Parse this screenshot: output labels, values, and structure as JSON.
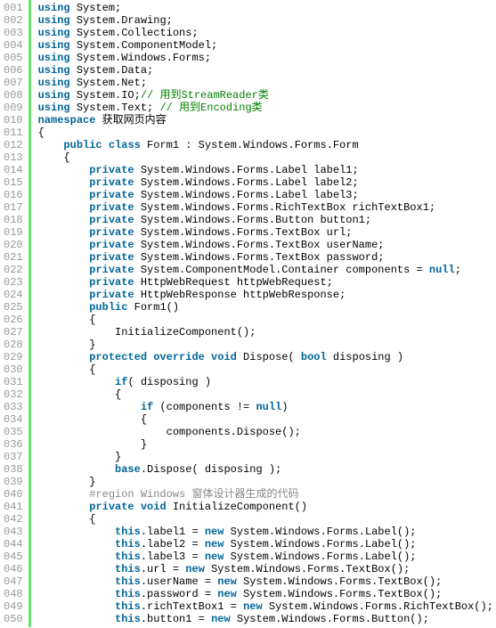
{
  "lines": [
    {
      "n": "001",
      "t": [
        [
          "kw",
          "using"
        ],
        [
          "pl",
          " System;"
        ]
      ]
    },
    {
      "n": "002",
      "t": [
        [
          "kw",
          "using"
        ],
        [
          "pl",
          " System.Drawing;"
        ]
      ]
    },
    {
      "n": "003",
      "t": [
        [
          "kw",
          "using"
        ],
        [
          "pl",
          " System.Collections;"
        ]
      ]
    },
    {
      "n": "004",
      "t": [
        [
          "kw",
          "using"
        ],
        [
          "pl",
          " System.ComponentModel;"
        ]
      ]
    },
    {
      "n": "005",
      "t": [
        [
          "kw",
          "using"
        ],
        [
          "pl",
          " System.Windows.Forms;"
        ]
      ]
    },
    {
      "n": "006",
      "t": [
        [
          "kw",
          "using"
        ],
        [
          "pl",
          " System.Data;"
        ]
      ]
    },
    {
      "n": "007",
      "t": [
        [
          "kw",
          "using"
        ],
        [
          "pl",
          " System.Net;"
        ]
      ]
    },
    {
      "n": "008",
      "t": [
        [
          "kw",
          "using"
        ],
        [
          "pl",
          " System.IO;"
        ],
        [
          "cmt",
          "// 用到StreamReader类"
        ]
      ]
    },
    {
      "n": "009",
      "t": [
        [
          "kw",
          "using"
        ],
        [
          "pl",
          " System.Text; "
        ],
        [
          "cmt",
          "// 用到Encoding类"
        ]
      ]
    },
    {
      "n": "010",
      "t": [
        [
          "kw",
          "namespace"
        ],
        [
          "pl",
          " 获取网页内容"
        ]
      ]
    },
    {
      "n": "011",
      "t": [
        [
          "pl",
          "{"
        ]
      ]
    },
    {
      "n": "012",
      "t": [
        [
          "pl",
          "    "
        ],
        [
          "kw",
          "public"
        ],
        [
          "pl",
          " "
        ],
        [
          "kw",
          "class"
        ],
        [
          "pl",
          " Form1 : System.Windows.Forms.Form"
        ]
      ]
    },
    {
      "n": "013",
      "t": [
        [
          "pl",
          "    {"
        ]
      ]
    },
    {
      "n": "014",
      "t": [
        [
          "pl",
          "        "
        ],
        [
          "kw",
          "private"
        ],
        [
          "pl",
          " System.Windows.Forms.Label label1;"
        ]
      ]
    },
    {
      "n": "015",
      "t": [
        [
          "pl",
          "        "
        ],
        [
          "kw",
          "private"
        ],
        [
          "pl",
          " System.Windows.Forms.Label label2;"
        ]
      ]
    },
    {
      "n": "016",
      "t": [
        [
          "pl",
          "        "
        ],
        [
          "kw",
          "private"
        ],
        [
          "pl",
          " System.Windows.Forms.Label label3;"
        ]
      ]
    },
    {
      "n": "017",
      "t": [
        [
          "pl",
          "        "
        ],
        [
          "kw",
          "private"
        ],
        [
          "pl",
          " System.Windows.Forms.RichTextBox richTextBox1;"
        ]
      ]
    },
    {
      "n": "018",
      "t": [
        [
          "pl",
          "        "
        ],
        [
          "kw",
          "private"
        ],
        [
          "pl",
          " System.Windows.Forms.Button button1;"
        ]
      ]
    },
    {
      "n": "019",
      "t": [
        [
          "pl",
          "        "
        ],
        [
          "kw",
          "private"
        ],
        [
          "pl",
          " System.Windows.Forms.TextBox url;"
        ]
      ]
    },
    {
      "n": "020",
      "t": [
        [
          "pl",
          "        "
        ],
        [
          "kw",
          "private"
        ],
        [
          "pl",
          " System.Windows.Forms.TextBox userName;"
        ]
      ]
    },
    {
      "n": "021",
      "t": [
        [
          "pl",
          "        "
        ],
        [
          "kw",
          "private"
        ],
        [
          "pl",
          " System.Windows.Forms.TextBox password;"
        ]
      ]
    },
    {
      "n": "022",
      "t": [
        [
          "pl",
          "        "
        ],
        [
          "kw",
          "private"
        ],
        [
          "pl",
          " System.ComponentModel.Container components = "
        ],
        [
          "kw",
          "null"
        ],
        [
          "pl",
          ";"
        ]
      ]
    },
    {
      "n": "023",
      "t": [
        [
          "pl",
          "        "
        ],
        [
          "kw",
          "private"
        ],
        [
          "pl",
          " HttpWebRequest httpWebRequest;"
        ]
      ]
    },
    {
      "n": "024",
      "t": [
        [
          "pl",
          "        "
        ],
        [
          "kw",
          "private"
        ],
        [
          "pl",
          " HttpWebResponse httpWebResponse;"
        ]
      ]
    },
    {
      "n": "025",
      "t": [
        [
          "pl",
          "        "
        ],
        [
          "kw",
          "public"
        ],
        [
          "pl",
          " Form1()"
        ]
      ]
    },
    {
      "n": "026",
      "t": [
        [
          "pl",
          "        {"
        ]
      ]
    },
    {
      "n": "027",
      "t": [
        [
          "pl",
          "            InitializeComponent();"
        ]
      ]
    },
    {
      "n": "028",
      "t": [
        [
          "pl",
          "        }"
        ]
      ]
    },
    {
      "n": "029",
      "t": [
        [
          "pl",
          "        "
        ],
        [
          "kw",
          "protected"
        ],
        [
          "pl",
          " "
        ],
        [
          "kw",
          "override"
        ],
        [
          "pl",
          " "
        ],
        [
          "kw",
          "void"
        ],
        [
          "pl",
          " Dispose( "
        ],
        [
          "kw",
          "bool"
        ],
        [
          "pl",
          " disposing )"
        ]
      ]
    },
    {
      "n": "030",
      "t": [
        [
          "pl",
          "        {"
        ]
      ]
    },
    {
      "n": "031",
      "t": [
        [
          "pl",
          "            "
        ],
        [
          "kw",
          "if"
        ],
        [
          "pl",
          "( disposing )"
        ]
      ]
    },
    {
      "n": "032",
      "t": [
        [
          "pl",
          "            {"
        ]
      ]
    },
    {
      "n": "033",
      "t": [
        [
          "pl",
          "                "
        ],
        [
          "kw",
          "if"
        ],
        [
          "pl",
          " (components != "
        ],
        [
          "kw",
          "null"
        ],
        [
          "pl",
          ")"
        ]
      ]
    },
    {
      "n": "034",
      "t": [
        [
          "pl",
          "                {"
        ]
      ]
    },
    {
      "n": "035",
      "t": [
        [
          "pl",
          "                    components.Dispose();"
        ]
      ]
    },
    {
      "n": "036",
      "t": [
        [
          "pl",
          "                }"
        ]
      ]
    },
    {
      "n": "037",
      "t": [
        [
          "pl",
          "            }"
        ]
      ]
    },
    {
      "n": "038",
      "t": [
        [
          "pl",
          "            "
        ],
        [
          "kw",
          "base"
        ],
        [
          "pl",
          ".Dispose( disposing );"
        ]
      ]
    },
    {
      "n": "039",
      "t": [
        [
          "pl",
          "        }"
        ]
      ]
    },
    {
      "n": "040",
      "t": [
        [
          "pl",
          "        "
        ],
        [
          "gr",
          "#region Windows 窗体设计器生成的代码"
        ]
      ]
    },
    {
      "n": "041",
      "t": [
        [
          "pl",
          "        "
        ],
        [
          "kw",
          "private"
        ],
        [
          "pl",
          " "
        ],
        [
          "kw",
          "void"
        ],
        [
          "pl",
          " InitializeComponent()"
        ]
      ]
    },
    {
      "n": "042",
      "t": [
        [
          "pl",
          "        {"
        ]
      ]
    },
    {
      "n": "043",
      "t": [
        [
          "pl",
          "            "
        ],
        [
          "kw",
          "this"
        ],
        [
          "pl",
          ".label1 = "
        ],
        [
          "kw",
          "new"
        ],
        [
          "pl",
          " System.Windows.Forms.Label();"
        ]
      ]
    },
    {
      "n": "044",
      "t": [
        [
          "pl",
          "            "
        ],
        [
          "kw",
          "this"
        ],
        [
          "pl",
          ".label2 = "
        ],
        [
          "kw",
          "new"
        ],
        [
          "pl",
          " System.Windows.Forms.Label();"
        ]
      ]
    },
    {
      "n": "045",
      "t": [
        [
          "pl",
          "            "
        ],
        [
          "kw",
          "this"
        ],
        [
          "pl",
          ".label3 = "
        ],
        [
          "kw",
          "new"
        ],
        [
          "pl",
          " System.Windows.Forms.Label();"
        ]
      ]
    },
    {
      "n": "046",
      "t": [
        [
          "pl",
          "            "
        ],
        [
          "kw",
          "this"
        ],
        [
          "pl",
          ".url = "
        ],
        [
          "kw",
          "new"
        ],
        [
          "pl",
          " System.Windows.Forms.TextBox();"
        ]
      ]
    },
    {
      "n": "047",
      "t": [
        [
          "pl",
          "            "
        ],
        [
          "kw",
          "this"
        ],
        [
          "pl",
          ".userName = "
        ],
        [
          "kw",
          "new"
        ],
        [
          "pl",
          " System.Windows.Forms.TextBox();"
        ]
      ]
    },
    {
      "n": "048",
      "t": [
        [
          "pl",
          "            "
        ],
        [
          "kw",
          "this"
        ],
        [
          "pl",
          ".password = "
        ],
        [
          "kw",
          "new"
        ],
        [
          "pl",
          " System.Windows.Forms.TextBox();"
        ]
      ]
    },
    {
      "n": "049",
      "t": [
        [
          "pl",
          "            "
        ],
        [
          "kw",
          "this"
        ],
        [
          "pl",
          ".richTextBox1 = "
        ],
        [
          "kw",
          "new"
        ],
        [
          "pl",
          " System.Windows.Forms.RichTextBox();"
        ]
      ]
    },
    {
      "n": "050",
      "t": [
        [
          "pl",
          "            "
        ],
        [
          "kw",
          "this"
        ],
        [
          "pl",
          ".button1 = "
        ],
        [
          "kw",
          "new"
        ],
        [
          "pl",
          " System.Windows.Forms.Button();"
        ]
      ]
    }
  ]
}
